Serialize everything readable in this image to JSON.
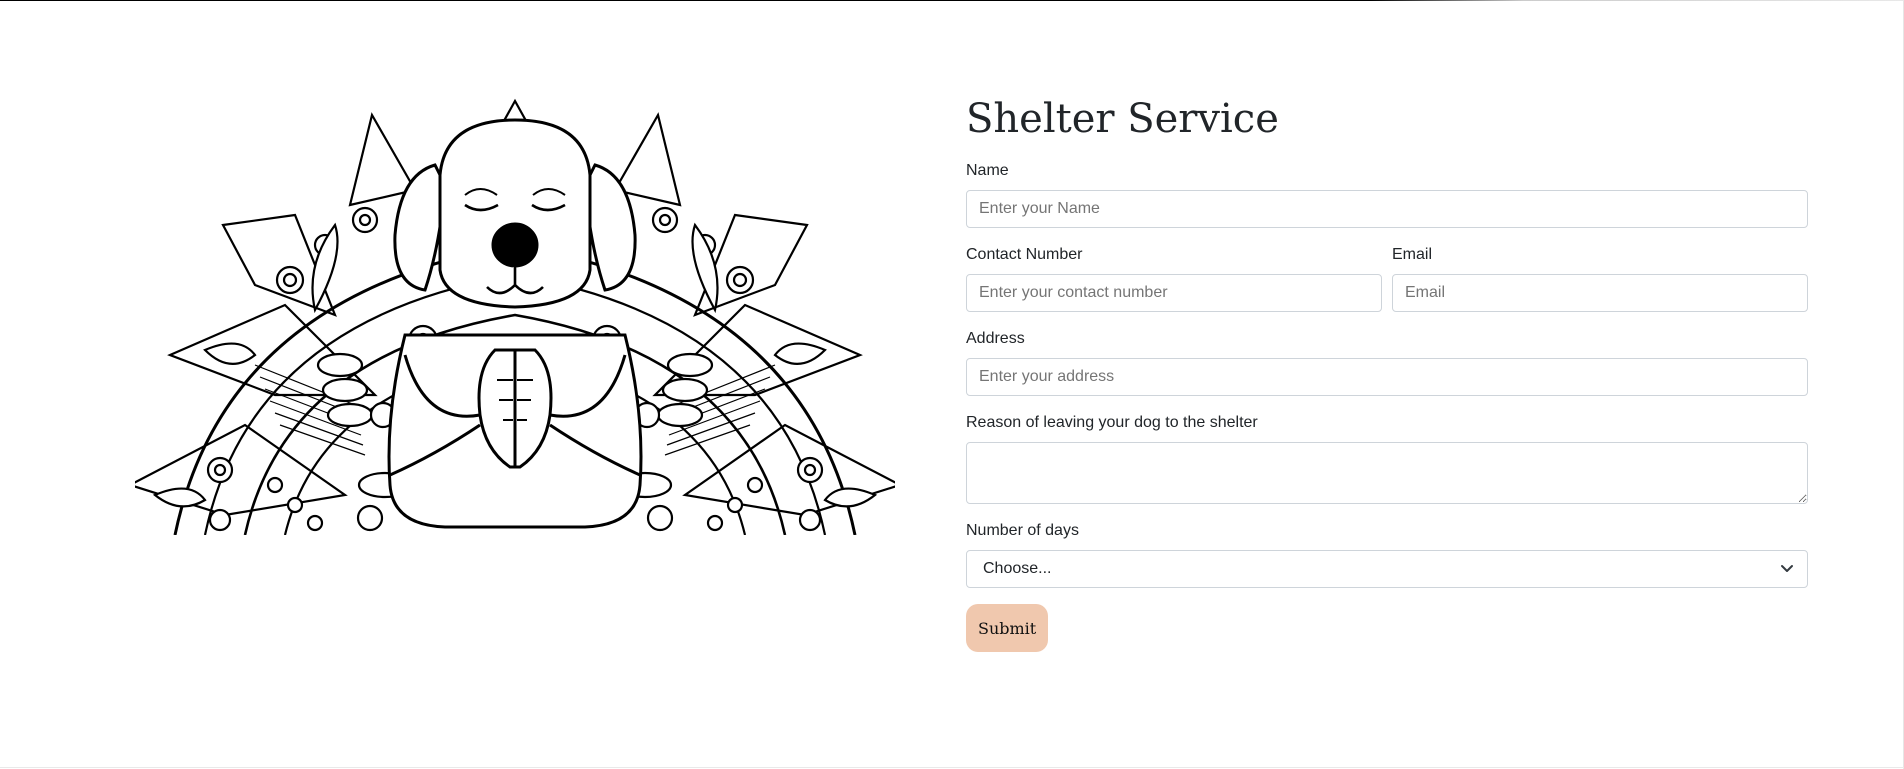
{
  "form": {
    "title": "Shelter Service",
    "name_label": "Name",
    "name_placeholder": "Enter your Name",
    "contact_label": "Contact Number",
    "contact_placeholder": "Enter your contact number",
    "email_label": "Email",
    "email_placeholder": "Email",
    "address_label": "Address",
    "address_placeholder": "Enter your address",
    "reason_label": "Reason of leaving your dog to the shelter",
    "reason_value": "",
    "days_label": "Number of days",
    "days_selected": "Choose...",
    "submit_label": "Submit"
  },
  "hero": {
    "icon": "meditating-dog-mandala-illustration"
  },
  "colors": {
    "submit_bg": "#f0c8ae",
    "border": "#ced4da",
    "placeholder": "#6c757d"
  }
}
